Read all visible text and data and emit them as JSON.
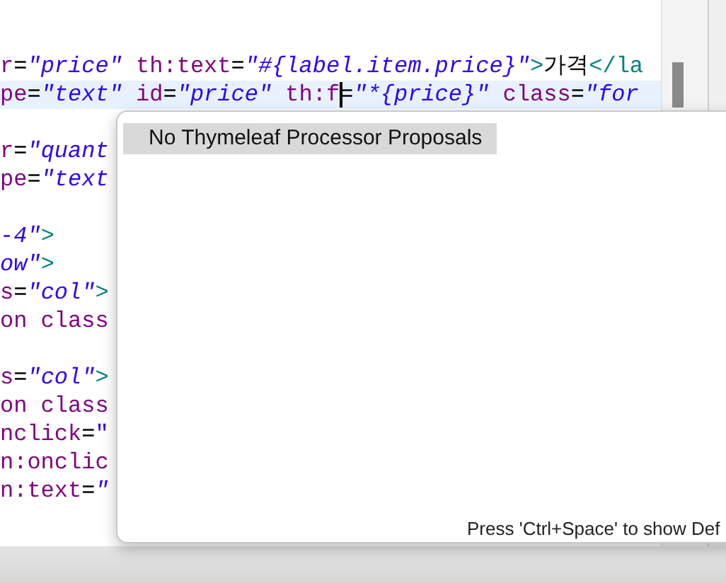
{
  "editor": {
    "lines": [
      {
        "current": false
      },
      {
        "current": false,
        "tokens": [
          {
            "kind": "attr",
            "text": "r"
          },
          {
            "kind": "eq",
            "text": "="
          },
          {
            "kind": "str",
            "text": "\"price\""
          },
          {
            "kind": "attr",
            "text": " th:text"
          },
          {
            "kind": "eq",
            "text": "="
          },
          {
            "kind": "str",
            "text": "\"#{label.item.price}\""
          },
          {
            "kind": "tag",
            "text": ">"
          },
          {
            "kind": "text",
            "text": "가격"
          },
          {
            "kind": "tag",
            "text": "</la"
          }
        ]
      },
      {
        "current": true,
        "tokens": [
          {
            "kind": "attr",
            "text": "pe"
          },
          {
            "kind": "eq",
            "text": "="
          },
          {
            "kind": "str",
            "text": "\"text\""
          },
          {
            "kind": "attr",
            "text": " id"
          },
          {
            "kind": "eq",
            "text": "="
          },
          {
            "kind": "str",
            "text": "\"price\""
          },
          {
            "kind": "attr",
            "text": " th:f"
          },
          {
            "kind": "caret"
          },
          {
            "kind": "eq",
            "text": "="
          },
          {
            "kind": "str",
            "text": "\"*{price}\""
          },
          {
            "kind": "attr",
            "text": " class"
          },
          {
            "kind": "eq",
            "text": "="
          },
          {
            "kind": "str",
            "text": "\"for"
          }
        ]
      },
      {
        "current": false
      },
      {
        "current": false,
        "tokens": [
          {
            "kind": "attr",
            "text": "r"
          },
          {
            "kind": "eq",
            "text": "="
          },
          {
            "kind": "str",
            "text": "\"quant"
          }
        ]
      },
      {
        "current": false,
        "tokens": [
          {
            "kind": "attr",
            "text": "pe"
          },
          {
            "kind": "eq",
            "text": "="
          },
          {
            "kind": "str",
            "text": "\"text"
          }
        ]
      },
      {
        "current": false
      },
      {
        "current": false,
        "tokens": [
          {
            "kind": "str",
            "text": "-4\""
          },
          {
            "kind": "tag",
            "text": ">"
          }
        ]
      },
      {
        "current": false,
        "tokens": [
          {
            "kind": "str",
            "text": "ow\""
          },
          {
            "kind": "tag",
            "text": ">"
          }
        ]
      },
      {
        "current": false,
        "tokens": [
          {
            "kind": "attr",
            "text": "s"
          },
          {
            "kind": "eq",
            "text": "="
          },
          {
            "kind": "str",
            "text": "\"col\""
          },
          {
            "kind": "tag",
            "text": ">"
          }
        ]
      },
      {
        "current": false,
        "tokens": [
          {
            "kind": "attr",
            "text": "on class"
          }
        ]
      },
      {
        "current": false
      },
      {
        "current": false,
        "tokens": [
          {
            "kind": "attr",
            "text": "s"
          },
          {
            "kind": "eq",
            "text": "="
          },
          {
            "kind": "str",
            "text": "\"col\""
          },
          {
            "kind": "tag",
            "text": ">"
          }
        ]
      },
      {
        "current": false,
        "tokens": [
          {
            "kind": "attr",
            "text": "on class"
          }
        ]
      },
      {
        "current": false,
        "tokens": [
          {
            "kind": "attr",
            "text": "nclick"
          },
          {
            "kind": "eq",
            "text": "="
          },
          {
            "kind": "plain",
            "text": "\""
          }
        ]
      },
      {
        "current": false,
        "tokens": [
          {
            "kind": "attr",
            "text": "n:onclic"
          }
        ]
      },
      {
        "current": false,
        "tokens": [
          {
            "kind": "attr",
            "text": "n:text"
          },
          {
            "kind": "eq",
            "text": "="
          },
          {
            "kind": "str",
            "text": "\""
          }
        ]
      }
    ]
  },
  "popup": {
    "proposals": [
      {
        "label": "No Thymeleaf Processor Proposals",
        "selected": true
      }
    ],
    "hint": "Press 'Ctrl+Space' to show Def"
  }
}
